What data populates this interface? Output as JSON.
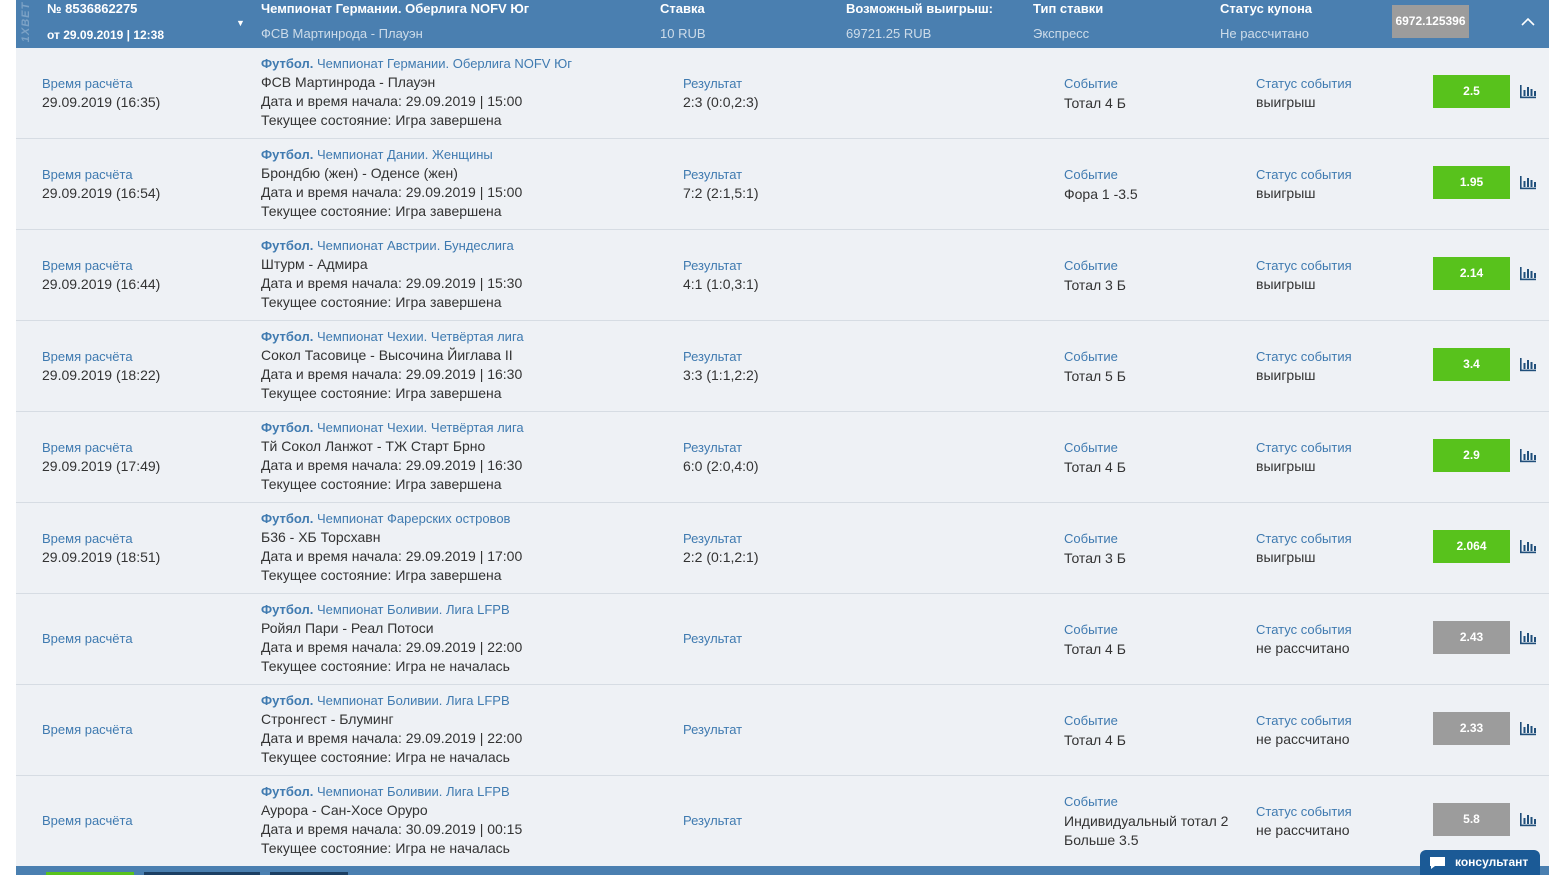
{
  "header": {
    "brand": "1XBET",
    "coupon_number": "№ 8536862275",
    "coupon_date": "от 29.09.2019 | 12:38",
    "event_title": "Чемпионат Германии. Оберлига NOFV Юг",
    "event_sub": "ФСВ Мартинрода - Плауэн",
    "stake_label": "Ставка",
    "stake_value": "10 RUB",
    "win_label": "Возможный выигрыш:",
    "win_value": "69721.25 RUB",
    "type_label": "Тип ставки",
    "type_value": "Экспресс",
    "status_label": "Статус купона",
    "status_value": "Не рассчитано",
    "total_odds": "6972.125396"
  },
  "labels": {
    "calc_time": "Время расчёта",
    "result": "Результат",
    "event": "Событие",
    "event_status": "Статус события",
    "sport": "Футбол."
  },
  "rows": [
    {
      "calc": "29.09.2019 (16:35)",
      "league": "Чемпионат Германии. Оберлига NOFV Юг",
      "teams": "ФСВ Мартинрода - Плауэн",
      "start": "Дата и время начала: 29.09.2019 | 15:00",
      "state": "Текущее состояние: Игра завершена",
      "result": "2:3 (0:0,2:3)",
      "event": "Тотал 4 Б",
      "status": "выигрыш",
      "odds": "2.5",
      "odds_state": "win"
    },
    {
      "calc": "29.09.2019 (16:54)",
      "league": "Чемпионат Дании. Женщины",
      "teams": "Брондбю (жен) - Оденсе (жен)",
      "start": "Дата и время начала: 29.09.2019 | 15:00",
      "state": "Текущее состояние: Игра завершена",
      "result": "7:2 (2:1,5:1)",
      "event": "Фора 1 -3.5",
      "status": "выигрыш",
      "odds": "1.95",
      "odds_state": "win"
    },
    {
      "calc": "29.09.2019 (16:44)",
      "league": "Чемпионат Австрии. Бундеслига",
      "teams": "Штурм - Адмира",
      "start": "Дата и время начала: 29.09.2019 | 15:30",
      "state": "Текущее состояние: Игра завершена",
      "result": "4:1 (1:0,3:1)",
      "event": "Тотал 3 Б",
      "status": "выигрыш",
      "odds": "2.14",
      "odds_state": "win"
    },
    {
      "calc": "29.09.2019 (18:22)",
      "league": "Чемпионат Чехии. Четвёртая лига",
      "teams": "Сокол Тасовице - Высочина Йиглава II",
      "start": "Дата и время начала: 29.09.2019 | 16:30",
      "state": "Текущее состояние: Игра завершена",
      "result": "3:3 (1:1,2:2)",
      "event": "Тотал 5 Б",
      "status": "выигрыш",
      "odds": "3.4",
      "odds_state": "win"
    },
    {
      "calc": "29.09.2019 (17:49)",
      "league": "Чемпионат Чехии. Четвёртая лига",
      "teams": "Тй Сокол Ланжот - ТЖ Старт Брно",
      "start": "Дата и время начала: 29.09.2019 | 16:30",
      "state": "Текущее состояние: Игра завершена",
      "result": "6:0 (2:0,4:0)",
      "event": "Тотал 4 Б",
      "status": "выигрыш",
      "odds": "2.9",
      "odds_state": "win"
    },
    {
      "calc": "29.09.2019 (18:51)",
      "league": "Чемпионат Фарерских островов",
      "teams": "Б36 - ХБ Торсхавн",
      "start": "Дата и время начала: 29.09.2019 | 17:00",
      "state": "Текущее состояние: Игра завершена",
      "result": "2:2 (0:1,2:1)",
      "event": "Тотал 3 Б",
      "status": "выигрыш",
      "odds": "2.064",
      "odds_state": "win"
    },
    {
      "calc": "",
      "league": "Чемпионат Боливии. Лига LFPB",
      "teams": "Ройял Пари - Реал Потоси",
      "start": "Дата и время начала: 29.09.2019 | 22:00",
      "state": "Текущее состояние: Игра не началась",
      "result": "",
      "event": "Тотал 4 Б",
      "status": "не рассчитано",
      "odds": "2.43",
      "odds_state": "pending"
    },
    {
      "calc": "",
      "league": "Чемпионат Боливии. Лига LFPB",
      "teams": "Стронгест - Блуминг",
      "start": "Дата и время начала: 29.09.2019 | 22:00",
      "state": "Текущее состояние: Игра не началась",
      "result": "",
      "event": "Тотал 4 Б",
      "status": "не рассчитано",
      "odds": "2.33",
      "odds_state": "pending"
    },
    {
      "calc": "",
      "league": "Чемпионат Боливии. Лига LFPB",
      "teams": "Аурора - Сан-Хосе Оруро",
      "start": "Дата и время начала: 30.09.2019 | 00:15",
      "state": "Текущее состояние: Игра не началась",
      "result": "",
      "event": "Индивидуальный тотал 2 Больше 3.5",
      "status": "не рассчитано",
      "odds": "5.8",
      "odds_state": "pending"
    }
  ],
  "consultant": "консультант",
  "colors": {
    "header_bg": "#4a7fb0",
    "win": "#58c21c",
    "pending": "#9c9c9c",
    "link": "#3f7ab0"
  }
}
